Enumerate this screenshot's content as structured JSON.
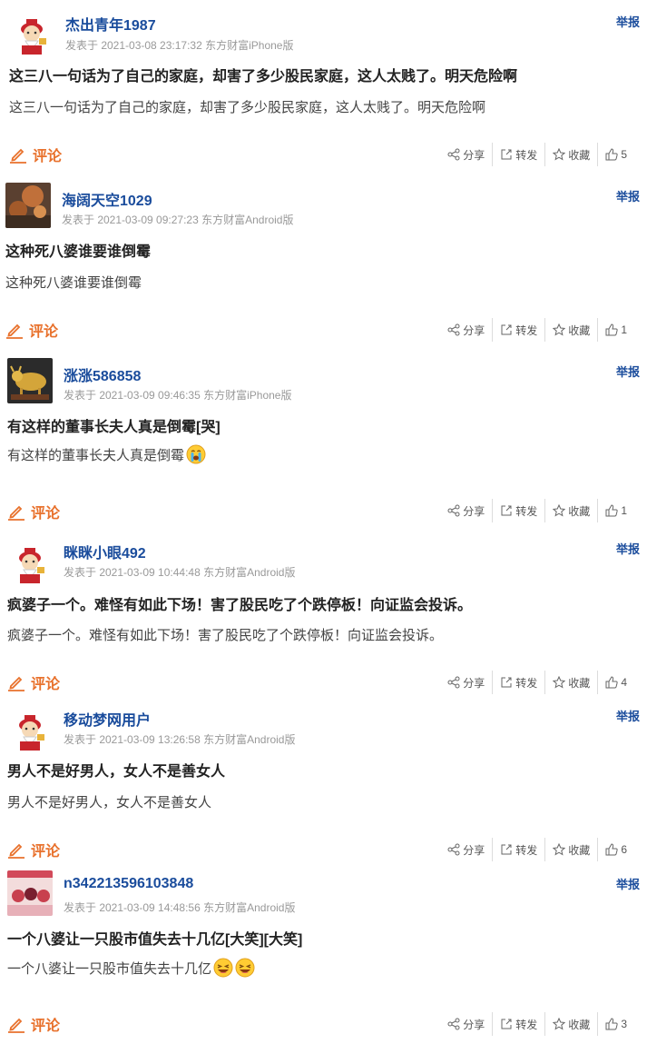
{
  "ui": {
    "report_label": "举报",
    "comment_label": "评论",
    "share_label": "分享",
    "forward_label": "转发",
    "collect_label": "收藏",
    "accent": "#e8712c",
    "link_color": "#1a4c9c"
  },
  "posts": [
    {
      "username": "杰出青年1987",
      "meta": "发表于 2021-03-08 23:17:32 东方财富iPhone版",
      "title": "这三八一句话为了自己的家庭，却害了多少股民家庭，这人太贱了。明天危险啊",
      "body": "这三八一句话为了自己的家庭，却害了多少股民家庭，这人太贱了。明天危险啊",
      "likes": "5",
      "avatar": "caishen-avatar"
    },
    {
      "username": "海阔天空1029",
      "meta": "发表于 2021-03-09 09:27:23 东方财富Android版",
      "title": "这种死八婆谁要谁倒霉",
      "body": "这种死八婆谁要谁倒霉",
      "likes": "1",
      "avatar": "photo-avatar"
    },
    {
      "username": "涨涨586858",
      "meta": "发表于 2021-03-09 09:46:35 东方财富iPhone版",
      "title": "有这样的董事长夫人真是倒霉[哭]",
      "body": "有这样的董事长夫人真是倒霉",
      "likes": "1",
      "avatar": "bull-avatar",
      "emojis": [
        "cry-emoji"
      ]
    },
    {
      "username": "眯眯小眼492",
      "meta": "发表于 2021-03-09 10:44:48 东方财富Android版",
      "title": "疯婆子一个。难怪有如此下场！害了股民吃了个跌停板！向证监会投诉。",
      "body": "疯婆子一个。难怪有如此下场！害了股民吃了个跌停板！向证监会投诉。",
      "likes": "4",
      "avatar": "caishen-avatar"
    },
    {
      "username": "移动梦网用户",
      "meta": "发表于 2021-03-09 13:26:58 东方财富Android版",
      "title": "男人不是好男人，女人不是善女人",
      "body": "男人不是好男人，女人不是善女人",
      "likes": "6",
      "avatar": "caishen-avatar"
    },
    {
      "username": "n342213596103848",
      "meta": "发表于 2021-03-09 14:48:56 东方财富Android版",
      "title": "一个八婆让一只股市值失去十几亿[大笑][大笑]",
      "body": "一个八婆让一只股市值失去十几亿",
      "likes": "3",
      "avatar": "pink-photo-avatar",
      "emojis": [
        "laugh-emoji",
        "laugh-emoji"
      ]
    }
  ]
}
